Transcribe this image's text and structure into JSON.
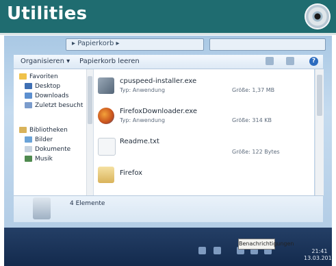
{
  "header": {
    "title": "Utilities"
  },
  "explorer": {
    "address_text": "▸ Papierkorb ▸",
    "toolbar": {
      "organize": "Organisieren ▾",
      "empty_bin": "Papierkorb leeren"
    },
    "nav": {
      "favorites": "Favoriten",
      "desktop": "Desktop",
      "downloads": "Downloads",
      "recent": "Zuletzt besucht",
      "libraries": "Bibliotheken",
      "pictures": "Bilder",
      "documents": "Dokumente",
      "music": "Musik"
    },
    "files": [
      {
        "name": "cpuspeed-installer.exe",
        "type": "Typ: Anwendung",
        "size": "Größe: 1,37 MB"
      },
      {
        "name": "FirefoxDownloader.exe",
        "type": "Typ: Anwendung",
        "size": "Größe: 314 KB"
      },
      {
        "name": "Readme.txt",
        "type": "",
        "size": "Größe: 122 Bytes"
      },
      {
        "name": "Firefox",
        "type": "",
        "size": ""
      }
    ],
    "details_text": "4 Elemente"
  },
  "taskbar": {
    "tooltip": "Benachrichtigungen",
    "time": "21:41",
    "date": "13.03.2012"
  },
  "colors": {
    "header_bg": "#1f6c70",
    "taskbar_bg": "#132a4d"
  }
}
